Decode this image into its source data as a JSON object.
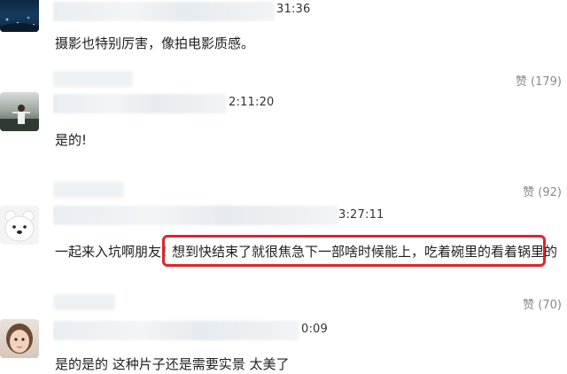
{
  "comments": [
    {
      "timestamp": "31:36",
      "text": "摄影也特别厉害，像拍电影质感。",
      "likes": "赞 (179)"
    },
    {
      "timestamp": "2:11:20",
      "text": "是的!",
      "likes": "赞 (92)"
    },
    {
      "timestamp": "3:27:11",
      "text": "一起来入坑啊朋友！",
      "highlighted_text": "想到快结束了就很焦急下一部啥时候能上，吃着碗里的看着锅里的",
      "likes": "赞 (70)"
    },
    {
      "timestamp": "0:09",
      "text": "是的是的 这种片子还是需要实景 太美了"
    }
  ],
  "colors": {
    "highlight_border": "#e0242b",
    "like_text": "#8a8a8a"
  }
}
